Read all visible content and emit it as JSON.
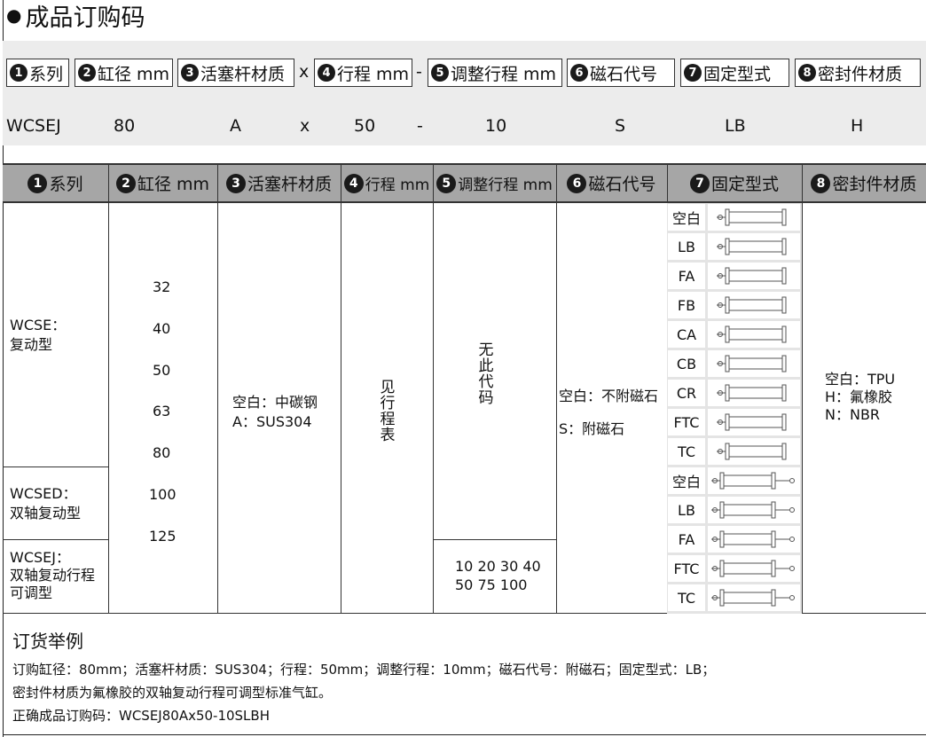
{
  "title": "成品订购码",
  "ordering_code": {
    "segments": [
      {
        "num": "1",
        "label": "系列"
      },
      {
        "num": "2",
        "label": "缸径 mm"
      },
      {
        "num": "3",
        "label": "活塞杆材质"
      },
      {
        "num": "4",
        "label": "行程 mm"
      },
      {
        "num": "5",
        "label": "调整行程 mm"
      },
      {
        "num": "6",
        "label": "磁石代号"
      },
      {
        "num": "7",
        "label": "固定型式"
      },
      {
        "num": "8",
        "label": "密封件材质"
      }
    ],
    "separators": [
      "x",
      "-"
    ],
    "example_values": [
      "WCSEJ",
      "80",
      "A",
      "x",
      "50",
      "-",
      "10",
      "S",
      "LB",
      "H"
    ]
  },
  "table": {
    "headers": [
      {
        "num": "1",
        "label": "系列"
      },
      {
        "num": "2",
        "label": "缸径 mm"
      },
      {
        "num": "3",
        "label": "活塞杆材质"
      },
      {
        "num": "4",
        "label": "行程 mm"
      },
      {
        "num": "5",
        "label": "调整行程 mm"
      },
      {
        "num": "6",
        "label": "磁石代号"
      },
      {
        "num": "7",
        "label": "固定型式"
      },
      {
        "num": "8",
        "label": "密封件材质"
      }
    ],
    "series": [
      {
        "code": "WCSE：",
        "name": "复动型"
      },
      {
        "code": "WCSED：",
        "name": "双轴复动型"
      },
      {
        "code": "WCSEJ：",
        "name": "双轴复动行程",
        "name2": "可调型"
      }
    ],
    "bores": [
      "32",
      "40",
      "50",
      "63",
      "80",
      "100",
      "125"
    ],
    "rod_material": [
      "空白：中碳钢",
      "A：SUS304"
    ],
    "stroke": "见行程表",
    "adjust_none": "无此代码",
    "adjust_values": [
      "10 20 30 40",
      "50 75 100"
    ],
    "magnet": [
      "空白：不附磁石",
      "S：附磁石"
    ],
    "mounting_single": [
      "空白",
      "LB",
      "FA",
      "FB",
      "CA",
      "CB",
      "CR",
      "FTC",
      "TC"
    ],
    "mounting_double": [
      "空白",
      "LB",
      "FA",
      "FTC",
      "TC"
    ],
    "seal": [
      "空白：TPU",
      "H：氟橡胶",
      "N：NBR"
    ]
  },
  "example": {
    "title": "订货举例",
    "line1": "订购缸径：80mm；活塞杆材质：SUS304；行程：50mm；调整行程：10mm；磁石代号：附磁石；固定型式：LB；",
    "line2": "密封件材质为氟橡胶的双轴复动行程可调型标准气缸。",
    "line3": "正确成品订购码：WCSEJ80Ax50-10SLBH"
  }
}
